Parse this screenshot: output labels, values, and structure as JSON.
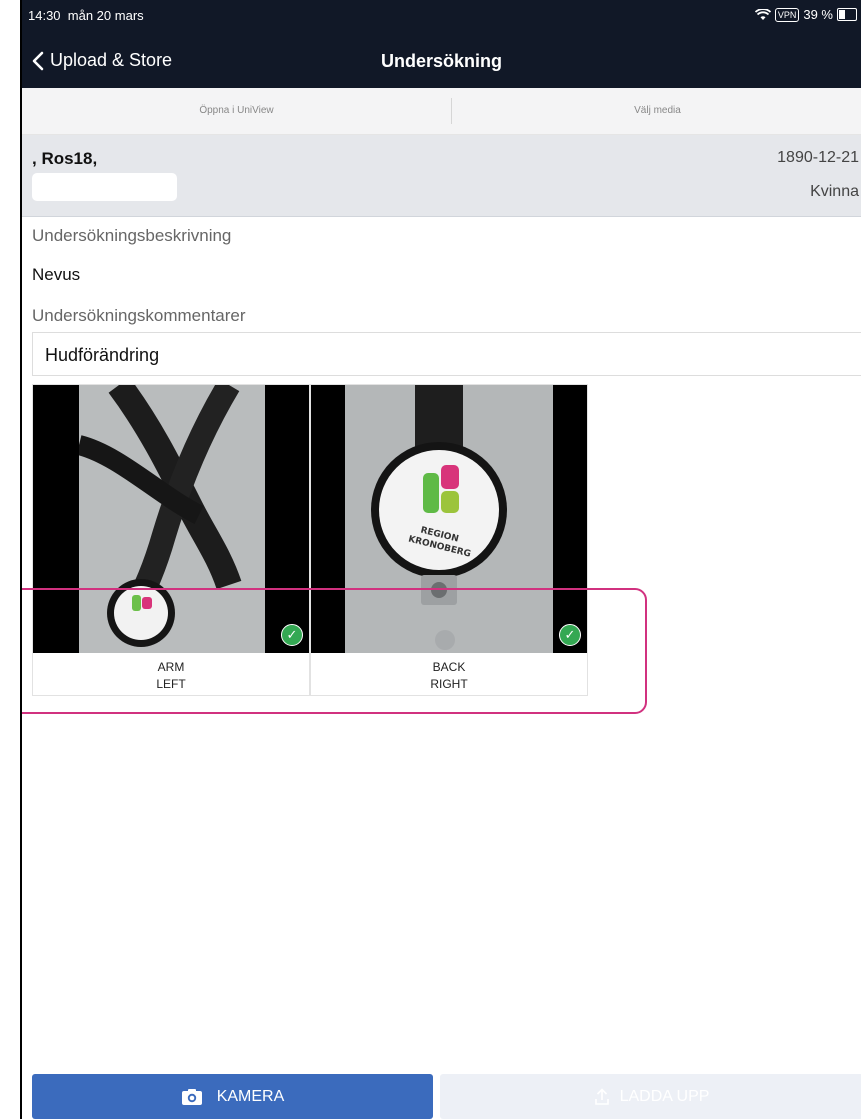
{
  "status_bar": {
    "time": "14:30",
    "date": "mån 20 mars",
    "vpn": "VPN",
    "battery": "39 %"
  },
  "nav": {
    "back_label": "Upload & Store",
    "title": "Undersökning"
  },
  "segments": [
    {
      "label": "Öppna i UniView"
    },
    {
      "label": "Välj media"
    }
  ],
  "patient": {
    "name": ", Ros18,",
    "dob": "1890-12-21",
    "sex": "Kvinna"
  },
  "exam": {
    "description_label": "Undersökningsbeskrivning",
    "description_value": "Nevus",
    "comments_label": "Undersökningskommentarer",
    "comments_value": "Hudförändring"
  },
  "images": [
    {
      "line1": "ARM",
      "line2": "LEFT",
      "uploaded": true
    },
    {
      "line1": "BACK",
      "line2": "RIGHT",
      "uploaded": true
    }
  ],
  "photo_text": {
    "badge_line1": "REGION",
    "badge_line2": "KRONOBERG"
  },
  "buttons": {
    "camera": "KAMERA",
    "upload": "LADDA UPP"
  },
  "colors": {
    "nav_bg": "#111827",
    "primary": "#3b6bbd",
    "highlight": "#d1317f",
    "check": "#34a853"
  },
  "icons": {
    "back": "chevron-left-icon",
    "camera": "camera-icon",
    "upload": "upload-icon",
    "check": "check-circle-icon",
    "wifi": "wifi-icon",
    "battery": "battery-icon"
  }
}
